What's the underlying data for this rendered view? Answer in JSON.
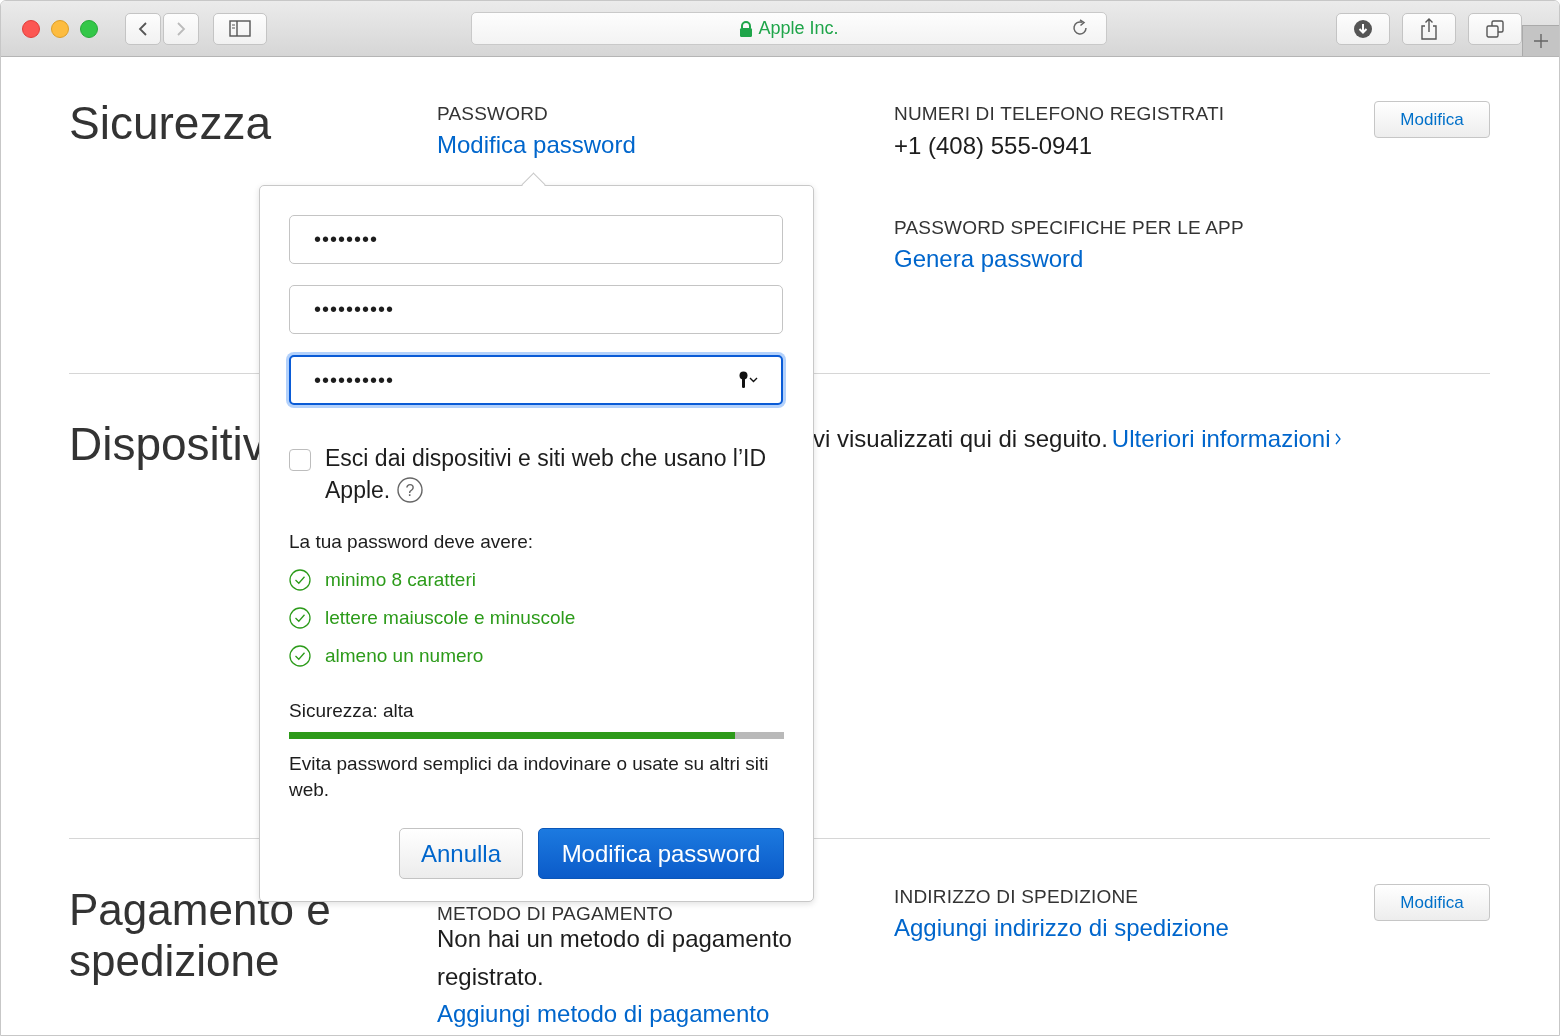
{
  "browser": {
    "address": "Apple Inc.",
    "secure": true,
    "back_disabled": false,
    "forward_disabled": true
  },
  "security": {
    "title": "Sicurezza",
    "password": {
      "label": "PASSWORD",
      "link": "Modifica password"
    },
    "phones": {
      "label": "NUMERI DI TELEFONO REGISTRATI",
      "number": "+1 (408) 555-0941",
      "button": "Modifica"
    },
    "app_passwords": {
      "label": "PASSWORD SPECIFICHE PER LE APP",
      "link": "Genera password"
    }
  },
  "devices": {
    "title": "Dispositiv",
    "description": "vi visualizzati qui di seguito.",
    "link": "Ulteriori informazioni"
  },
  "payment": {
    "title": "Pagamento e spedizione",
    "method": {
      "label": "METODO DI PAGAMENTO",
      "text": "Non hai un metodo di pagamento registrato.",
      "link": "Aggiungi metodo di pagamento"
    },
    "shipping": {
      "label": "INDIRIZZO DI SPEDIZIONE",
      "link": "Aggiungi indirizzo di spedizione",
      "button": "Modifica"
    }
  },
  "popover": {
    "fields": [
      {
        "value": "••••••••",
        "focused": false
      },
      {
        "value": "••••••••••",
        "focused": false
      },
      {
        "value": "••••••••••",
        "focused": true
      }
    ],
    "signout": {
      "label": "Esci dai dispositivi e siti web che usano l’ID Apple.",
      "checked": false,
      "help": "?"
    },
    "requirements_title": "La tua password deve avere:",
    "requirements": [
      {
        "text": "minimo 8 caratteri",
        "met": true
      },
      {
        "text": "lettere maiuscole e minuscole",
        "met": true
      },
      {
        "text": "almeno un numero",
        "met": true
      }
    ],
    "strength": {
      "label": "Sicurezza: alta",
      "level": 0.9
    },
    "hint": "Evita password semplici da indovinare o usate su altri siti web.",
    "buttons": [
      {
        "label": "Annulla",
        "kind": "secondary"
      },
      {
        "label": "Modifica password",
        "kind": "primary"
      }
    ]
  }
}
